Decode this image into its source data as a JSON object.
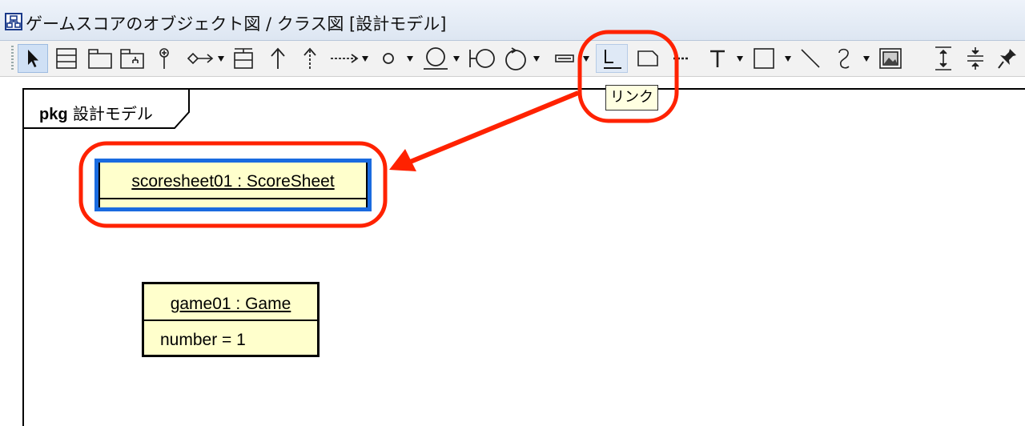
{
  "window": {
    "title": "ゲームスコアのオブジェクト図 / クラス図 [設計モデル]",
    "icon": "diagram-icon"
  },
  "toolbar": {
    "tools": [
      {
        "name": "selection-arrow-icon"
      },
      {
        "name": "class-icon"
      },
      {
        "name": "package-icon"
      },
      {
        "name": "subsystem-icon"
      },
      {
        "name": "interface-lollipop-icon"
      },
      {
        "name": "association-icon"
      },
      {
        "name": "instance-spec-icon"
      },
      {
        "name": "generalization-icon"
      },
      {
        "name": "realization-icon"
      },
      {
        "name": "dependency-icon"
      },
      {
        "name": "node-icon"
      },
      {
        "name": "socket-icon"
      },
      {
        "name": "lollipop-socket-icon"
      },
      {
        "name": "cycle-icon"
      },
      {
        "name": "attribute-icon"
      },
      {
        "name": "link-icon"
      },
      {
        "name": "note-icon"
      },
      {
        "name": "note-anchor-icon"
      },
      {
        "name": "text-icon"
      },
      {
        "name": "rectangle-icon"
      },
      {
        "name": "line-icon"
      },
      {
        "name": "freehand-icon"
      },
      {
        "name": "image-icon"
      },
      {
        "name": "vertical-space-icon"
      },
      {
        "name": "horizontal-space-icon"
      },
      {
        "name": "pin-icon"
      }
    ],
    "tooltip": "リンク"
  },
  "diagram": {
    "package_keyword": "pkg",
    "package_name": "設計モデル",
    "objects": [
      {
        "name": "scoresheet01 : ScoreSheet",
        "attributes": []
      },
      {
        "name": "game01 : Game",
        "attributes": [
          "number = 1"
        ]
      }
    ]
  },
  "colors": {
    "object_fill": "#ffffcc",
    "selection": "#1a6be0",
    "annotation": "#ff2200",
    "tooltip_bg": "#ffffe1"
  }
}
